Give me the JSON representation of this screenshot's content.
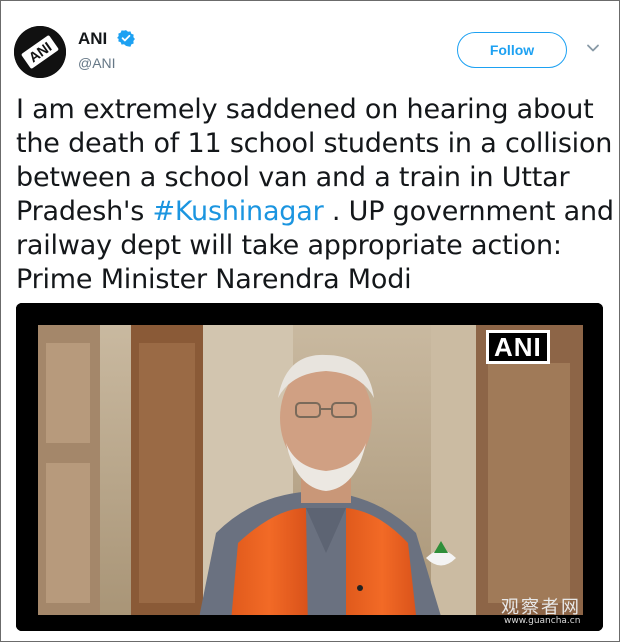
{
  "tweet": {
    "author_name": "ANI",
    "author_handle": "@ANI",
    "follow_label": "Follow",
    "avatar_text": "ANI",
    "text_lines": [
      [
        "I am extremely saddened on hearing about"
      ],
      [
        "the death of 11 school students in a collision"
      ],
      [
        "between a school van and a train in Uttar"
      ],
      [
        "Pradesh's ",
        "#Kushinagar",
        " . UP government and"
      ],
      [
        "railway dept will take appropriate action:"
      ],
      [
        "Prime Minister Narendra Modi"
      ]
    ],
    "line1": "I am extremely saddened on hearing about",
    "line2": "the death of 11 school students in a collision",
    "line3": "between a school van and a train in Uttar",
    "line4_pre": "Pradesh's ",
    "line4_hashtag": "#Kushinagar",
    "line4_post": " . UP government and",
    "line5": "railway dept will take appropriate action:",
    "line6": "Prime Minister Narendra Modi"
  },
  "media": {
    "ani_badge": "ANI",
    "watermark_cn": "观察者网",
    "watermark_url": "www.guancha.cn"
  },
  "colors": {
    "accent": "#1da1f2",
    "hashtag": "#1b95e0",
    "text": "#14171a",
    "muted": "#657786"
  },
  "icons": {
    "verified": "verified-badge-icon",
    "more": "chevron-down-icon"
  }
}
